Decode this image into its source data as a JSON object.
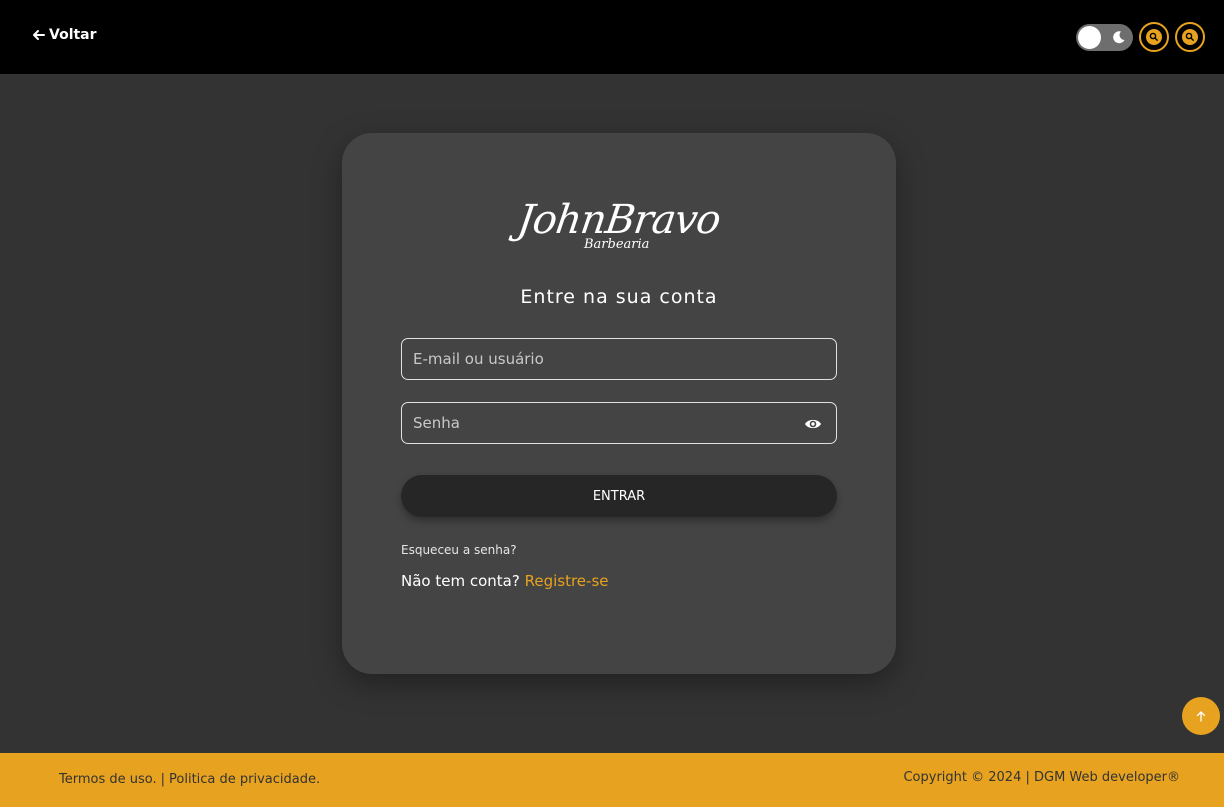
{
  "header": {
    "back_label": "Voltar"
  },
  "login": {
    "logo_main": "JohnBravo",
    "logo_sub": "Barbearia",
    "title": "Entre na sua conta",
    "email_placeholder": "E-mail ou usuário",
    "email_value": "",
    "password_placeholder": "Senha",
    "password_value": "",
    "submit_label": "ENTRAR",
    "forgot_label": "Esqueceu a senha?",
    "no_account_label": "Não tem conta?",
    "register_label": "Registre-se"
  },
  "footer": {
    "terms_label": "Termos de uso.",
    "separator": "|",
    "privacy_label": "Politica de privacidade.",
    "copyright": "Copyright © 2024 | DGM Web developer®"
  },
  "colors": {
    "accent": "#e7a21f",
    "background": "#333333",
    "card": "#444444",
    "header": "#000000"
  },
  "icons": {
    "back": "arrow-left-icon",
    "theme": "moon-icon",
    "zoom_in": "zoom-in-icon",
    "zoom_out": "zoom-out-icon",
    "password_toggle": "eye-icon",
    "scroll_top": "arrow-up-icon"
  }
}
